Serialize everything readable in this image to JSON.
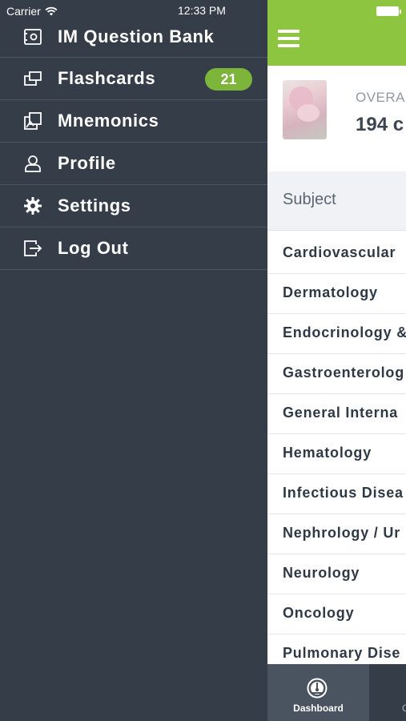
{
  "status_bar": {
    "carrier": "Carrier",
    "time": "12:33 PM"
  },
  "drawer": {
    "items": [
      {
        "label": "IM Question Bank",
        "icon": "question-bank-icon"
      },
      {
        "label": "Flashcards",
        "icon": "flashcards-icon",
        "badge": "21"
      },
      {
        "label": "Mnemonics",
        "icon": "mnemonics-icon"
      },
      {
        "label": "Profile",
        "icon": "profile-icon"
      },
      {
        "label": "Settings",
        "icon": "gear-icon"
      },
      {
        "label": "Log Out",
        "icon": "logout-icon"
      }
    ]
  },
  "main": {
    "overall_label": "OVERAL",
    "overall_value": "194 c",
    "subject_header": "Subject",
    "subjects": [
      "Cardiovascular",
      "Dermatology",
      "Endocrinology &",
      "Gastroenterolog",
      "General Interna",
      "Hematology",
      "Infectious Disea",
      "Nephrology / Ur",
      "Neurology",
      "Oncology",
      "Pulmonary Dise"
    ]
  },
  "tabbar": {
    "dashboard_label": "Dashboard",
    "next_label": "C"
  },
  "colors": {
    "drawer_bg": "#343d48",
    "accent_green": "#8ec540",
    "badge_green": "#7cb53a"
  }
}
